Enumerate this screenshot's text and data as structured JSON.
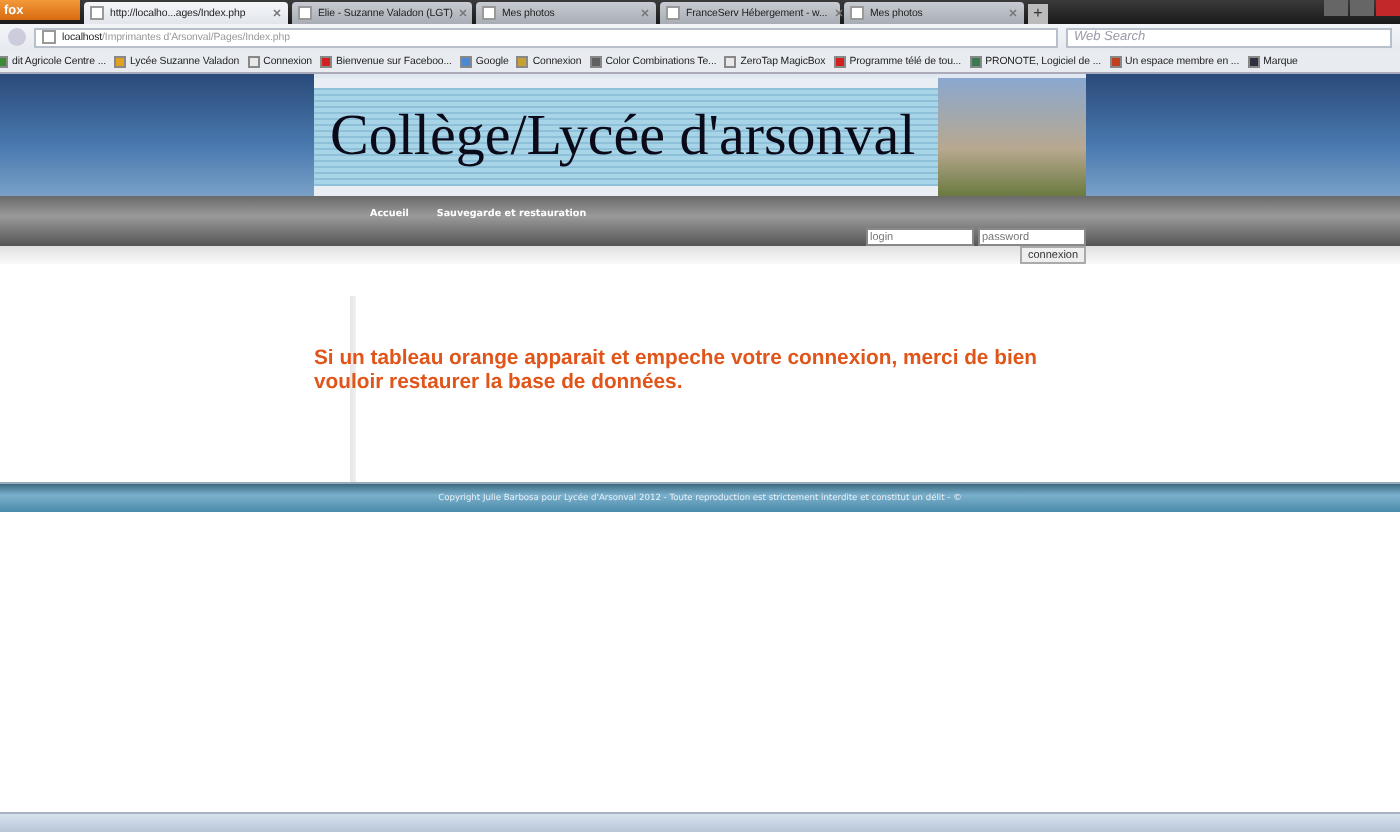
{
  "browser": {
    "menu_button": "fox",
    "tabs": [
      {
        "title": "http://localho...ages/Index.php",
        "selected": true
      },
      {
        "title": "Elie - Suzanne Valadon (LGT)",
        "selected": false
      },
      {
        "title": "Mes photos",
        "selected": false
      },
      {
        "title": "FranceServ Hébergement - w...",
        "selected": false
      },
      {
        "title": "Mes photos",
        "selected": false
      }
    ],
    "new_tab": "+",
    "address": {
      "host": "localhost",
      "path": "/Imprimantes d'Arsonval/Pages/Index.php"
    },
    "search": {
      "placeholder": "Web Search"
    },
    "bookmarks": [
      {
        "label": "dit Agricole Centre ...",
        "color": "#3a8a3a"
      },
      {
        "label": "Lycée Suzanne Valadon",
        "color": "#e0a020"
      },
      {
        "label": "Connexion",
        "color": "#e8e8e8"
      },
      {
        "label": "Bienvenue sur Faceboo...",
        "color": "#d02020"
      },
      {
        "label": "Google",
        "color": "#4a8ad0"
      },
      {
        "label": "Connexion",
        "color": "#c8a030"
      },
      {
        "label": "Color Combinations Te...",
        "color": "#606060"
      },
      {
        "label": "ZeroTap MagicBox",
        "color": "#e8e8e8"
      },
      {
        "label": "Programme télé de tou...",
        "color": "#d02020"
      },
      {
        "label": "PRONOTE, Logiciel de ...",
        "color": "#3a7a50"
      },
      {
        "label": "Un espace membre en ...",
        "color": "#c04020"
      },
      {
        "label": "Marque",
        "color": "#303040"
      }
    ]
  },
  "site": {
    "title": "Collège/Lycée d'arsonval",
    "nav": [
      "Accueil",
      "Sauvegarde et restauration"
    ],
    "login": {
      "placeholder": "login"
    },
    "password": {
      "placeholder": "password"
    },
    "connect_button": "connexion",
    "message": "Si un tableau orange apparait et empeche votre connexion, merci de bien vouloir restaurer la base de données.",
    "footer": "Copyright Julie Barbosa pour Lycée d'Arsonval 2012 - Toute reproduction est strictement interdite et constitut un délit - ©"
  }
}
